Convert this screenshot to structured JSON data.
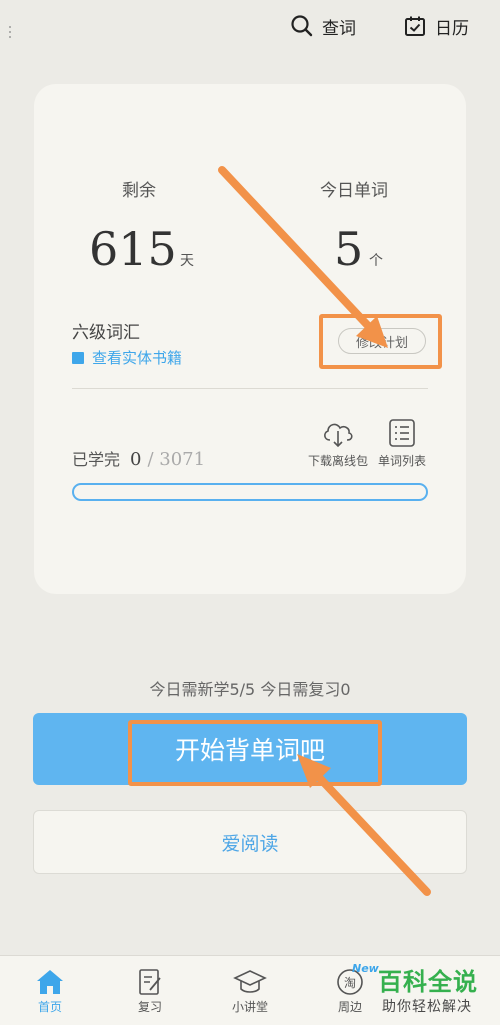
{
  "header": {
    "search_label": "查词",
    "calendar_label": "日历"
  },
  "plan_card": {
    "remaining_label": "剩余",
    "remaining_value": "615",
    "remaining_unit": "天",
    "today_words_label": "今日单词",
    "today_words_value": "5",
    "today_words_unit": "个",
    "book_name": "六级词汇",
    "view_book_label": "查看实体书籍",
    "modify_plan_label": "修改计划",
    "learned_label": "已学完",
    "learned_count": "0",
    "total_count": "/ 3071",
    "learned_fraction": 0,
    "download_label": "下载离线包",
    "word_list_label": "单词列表"
  },
  "today": {
    "summary": "今日需新学5/5  今日需复习0"
  },
  "actions": {
    "start_label": "开始背单词吧",
    "read_label": "爱阅读"
  },
  "tabbar": {
    "items": [
      {
        "label": "首页",
        "icon": "home-icon",
        "active": true
      },
      {
        "label": "复习",
        "icon": "review-icon",
        "active": false
      },
      {
        "label": "小讲堂",
        "icon": "lecture-icon",
        "active": false
      },
      {
        "label": "周边",
        "icon": "taobao-icon",
        "active": false
      }
    ],
    "new_badge": "New"
  },
  "watermark": {
    "title": "百科全说",
    "subtitle": "助你轻松解决"
  },
  "colors": {
    "accent": "#5fb5f0",
    "highlight": "#f29249",
    "background": "#ecebe6",
    "watermark_green": "#35b04e"
  }
}
